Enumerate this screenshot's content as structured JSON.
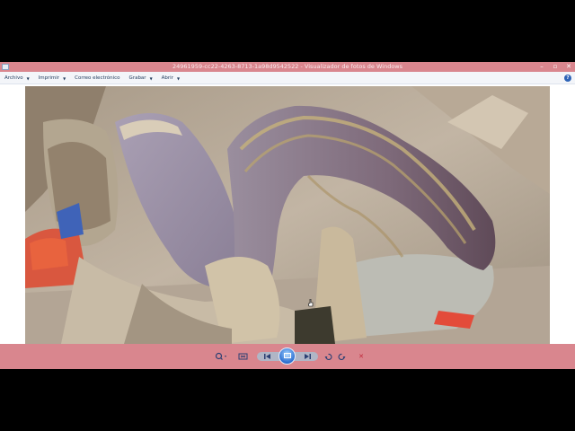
{
  "window": {
    "title": "24961959-cc22-4263-8713-1a98d9542522 - Visualizador de fotos de Windows"
  },
  "menu": {
    "items": [
      {
        "label": "Archivo",
        "has_dropdown": true
      },
      {
        "label": "Imprimir",
        "has_dropdown": true
      },
      {
        "label": "Correo electrónico",
        "has_dropdown": false
      },
      {
        "label": "Grabar",
        "has_dropdown": true
      },
      {
        "label": "Abrir",
        "has_dropdown": true
      }
    ],
    "help_label": "?"
  },
  "colors": {
    "titlebar": "#d9868e",
    "toolbar": "#d9868e",
    "menubar": "#f3f5f9",
    "menu_text": "#1e395b"
  },
  "icons": {
    "toolbar": [
      "zoom-icon",
      "actual-size-icon",
      "previous-icon",
      "slideshow-icon",
      "next-icon",
      "rotate-left-icon",
      "rotate-right-icon",
      "delete-icon"
    ]
  }
}
